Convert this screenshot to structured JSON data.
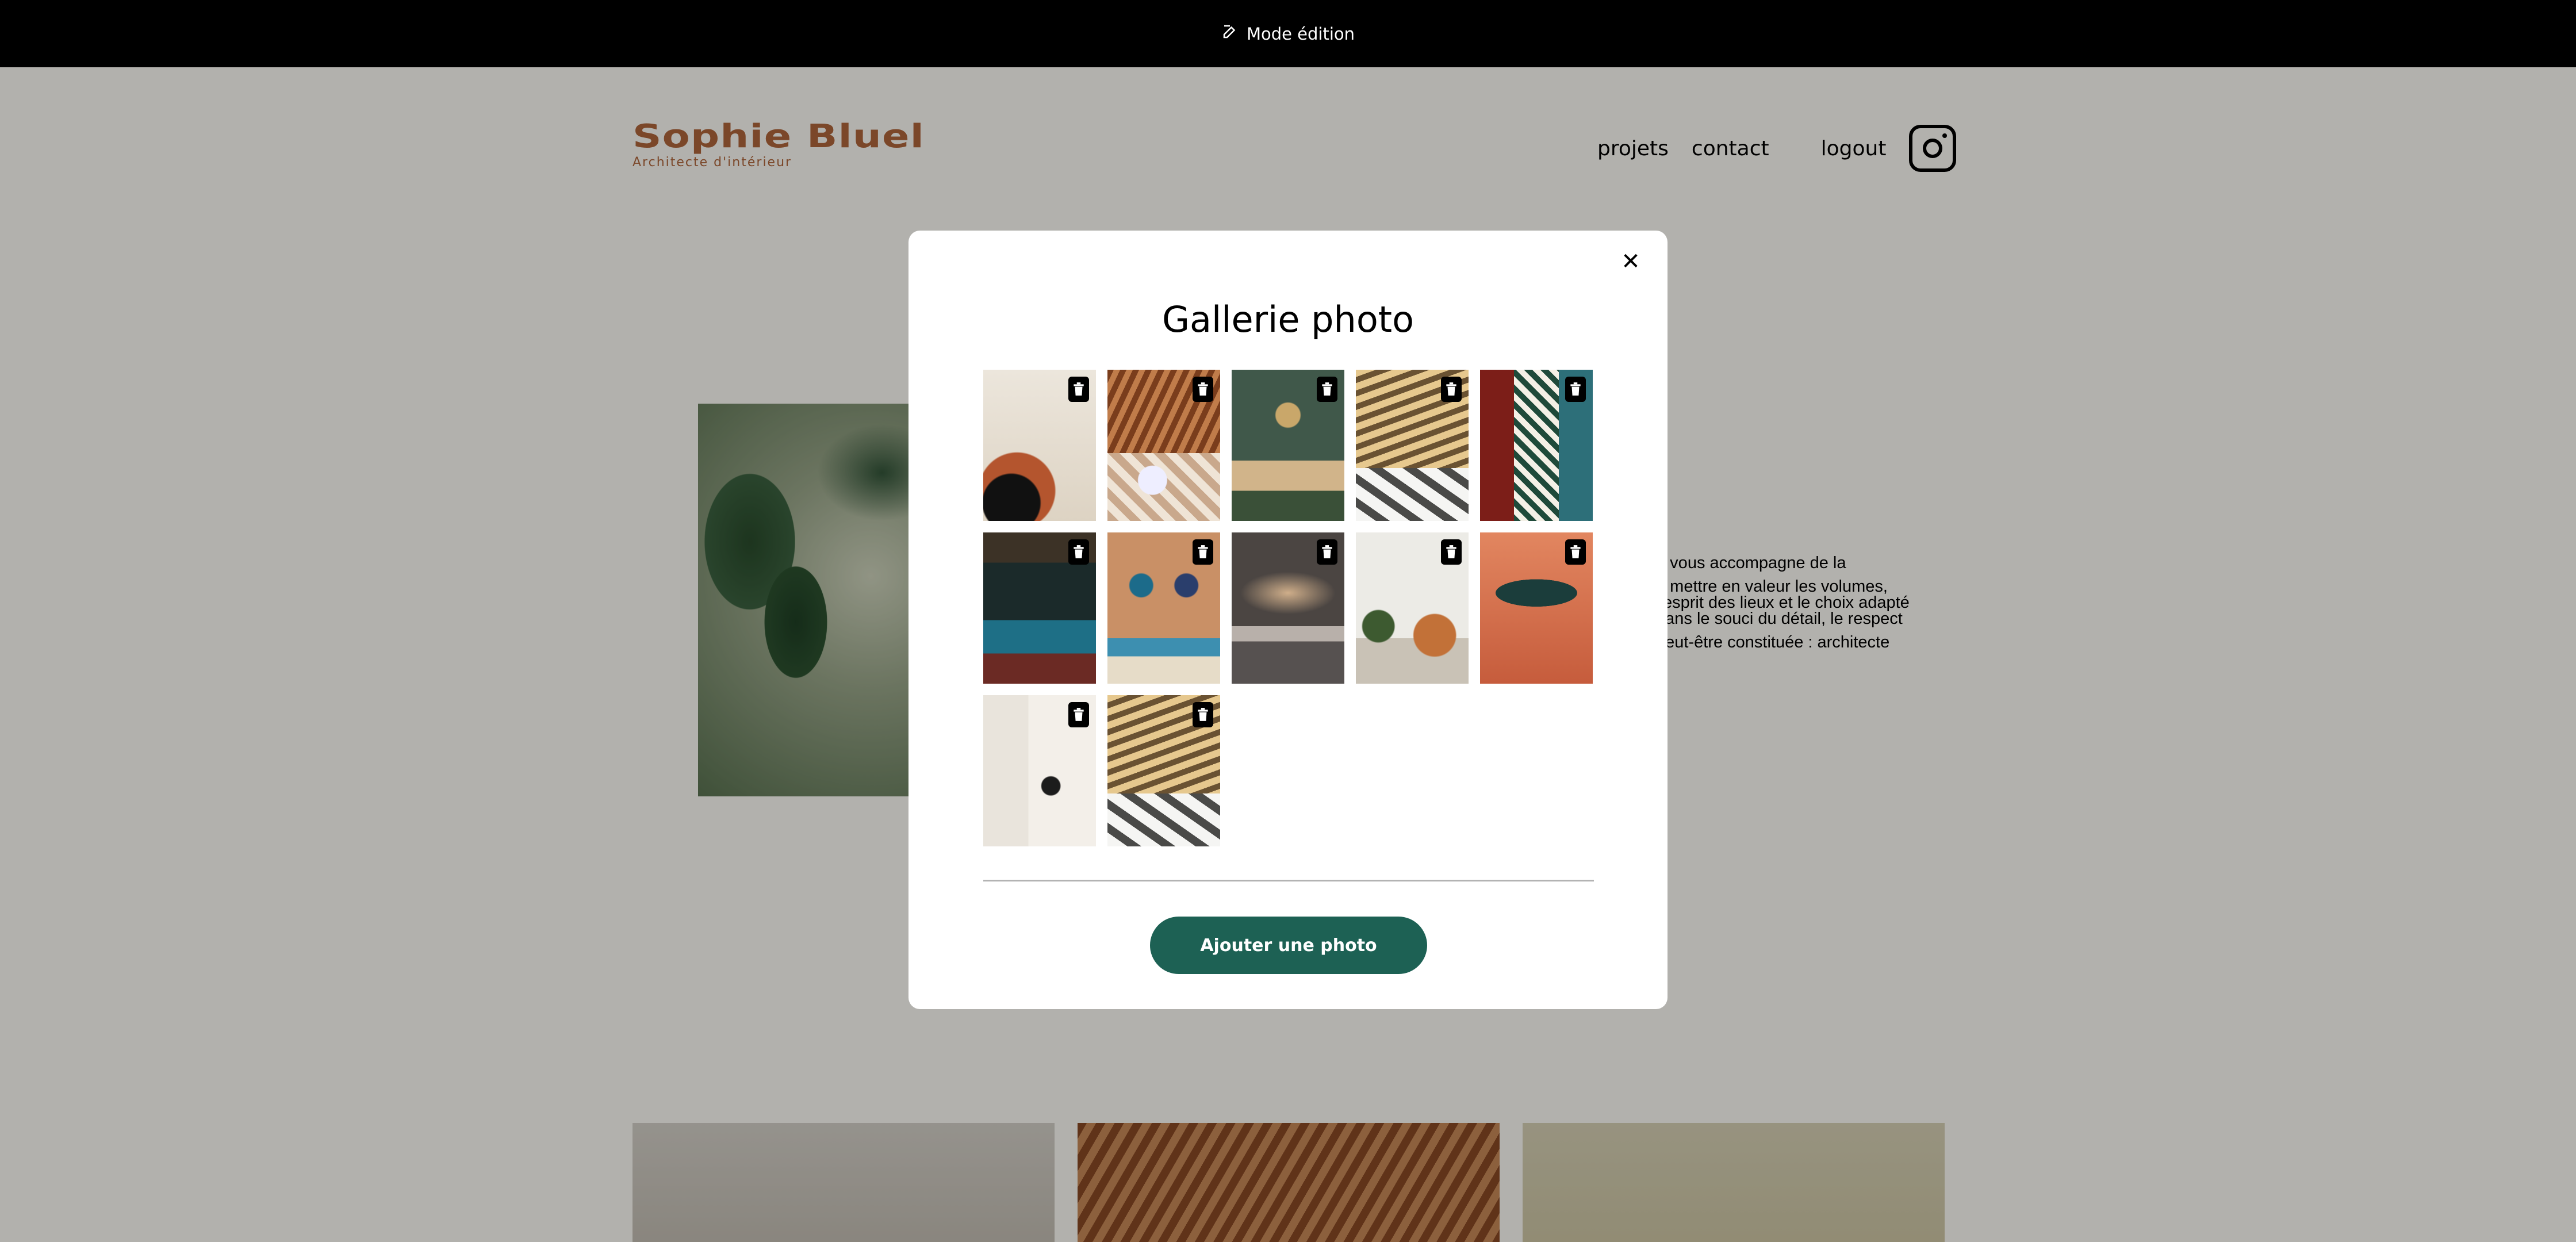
{
  "edit_bar": {
    "label": "Mode édition",
    "icon": "edit-icon"
  },
  "header": {
    "logo_title": "Sophie Bluel",
    "logo_subtitle": "Architecte d'intérieur",
    "nav": {
      "projects": "projets",
      "contact": "contact",
      "logout": "logout"
    },
    "social_icon": "instagram-icon"
  },
  "intro": {
    "lines": [
      "e vous accompagne de la",
      "à mettre en valeur les volumes,",
      "l'esprit des lieux et le choix adapté",
      "dans le souci du détail, le respect",
      "peut-être constituée : architecte"
    ]
  },
  "modal": {
    "title": "Gallerie photo",
    "close_icon": "close-icon",
    "photo_count": 12,
    "delete_icon": "trash-icon",
    "add_button": "Ajouter une photo"
  },
  "colors": {
    "brand": "#b1663c",
    "button": "#1d6154",
    "edit_bar": "#000000",
    "overlay": "rgba(0,0,0,0.30)"
  }
}
